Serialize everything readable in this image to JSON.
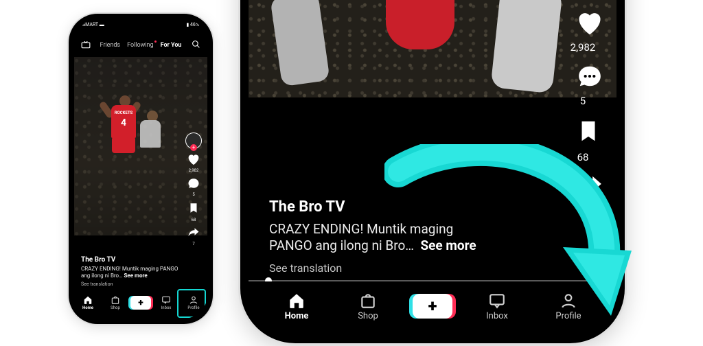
{
  "colors": {
    "accent": "#14d7d2",
    "like": "#ff2d55"
  },
  "small_phone": {
    "status_left": "SMART ▬",
    "status_right": "▮ 46%",
    "tabs": {
      "live": "LIVE",
      "friends": "Friends",
      "following": "Following",
      "foryou": "For You"
    },
    "rail": {
      "likes": "2,982",
      "comments": "5",
      "saves": "68",
      "shares": "7"
    },
    "author": "The Bro TV",
    "caption": "CRAZY ENDING! Muntik maging PANGO ang ilong ni Bro…",
    "see_more": "See more",
    "see_translation": "See translation",
    "nav": {
      "home": "Home",
      "shop": "Shop",
      "inbox": "Inbox",
      "profile": "Profile"
    },
    "jersey_team": "ROCKETS",
    "jersey_number": "4"
  },
  "big_phone": {
    "rail": {
      "likes": "2,982",
      "comments": "5",
      "saves": "68"
    },
    "author": "The Bro TV",
    "caption_line1": "CRAZY ENDING! Muntik maging",
    "caption_line2": "PANGO ang ilong ni Bro…",
    "see_more": "See more",
    "see_translation": "See translation",
    "nav": {
      "home": "Home",
      "shop": "Shop",
      "inbox": "Inbox",
      "profile": "Profile"
    }
  }
}
